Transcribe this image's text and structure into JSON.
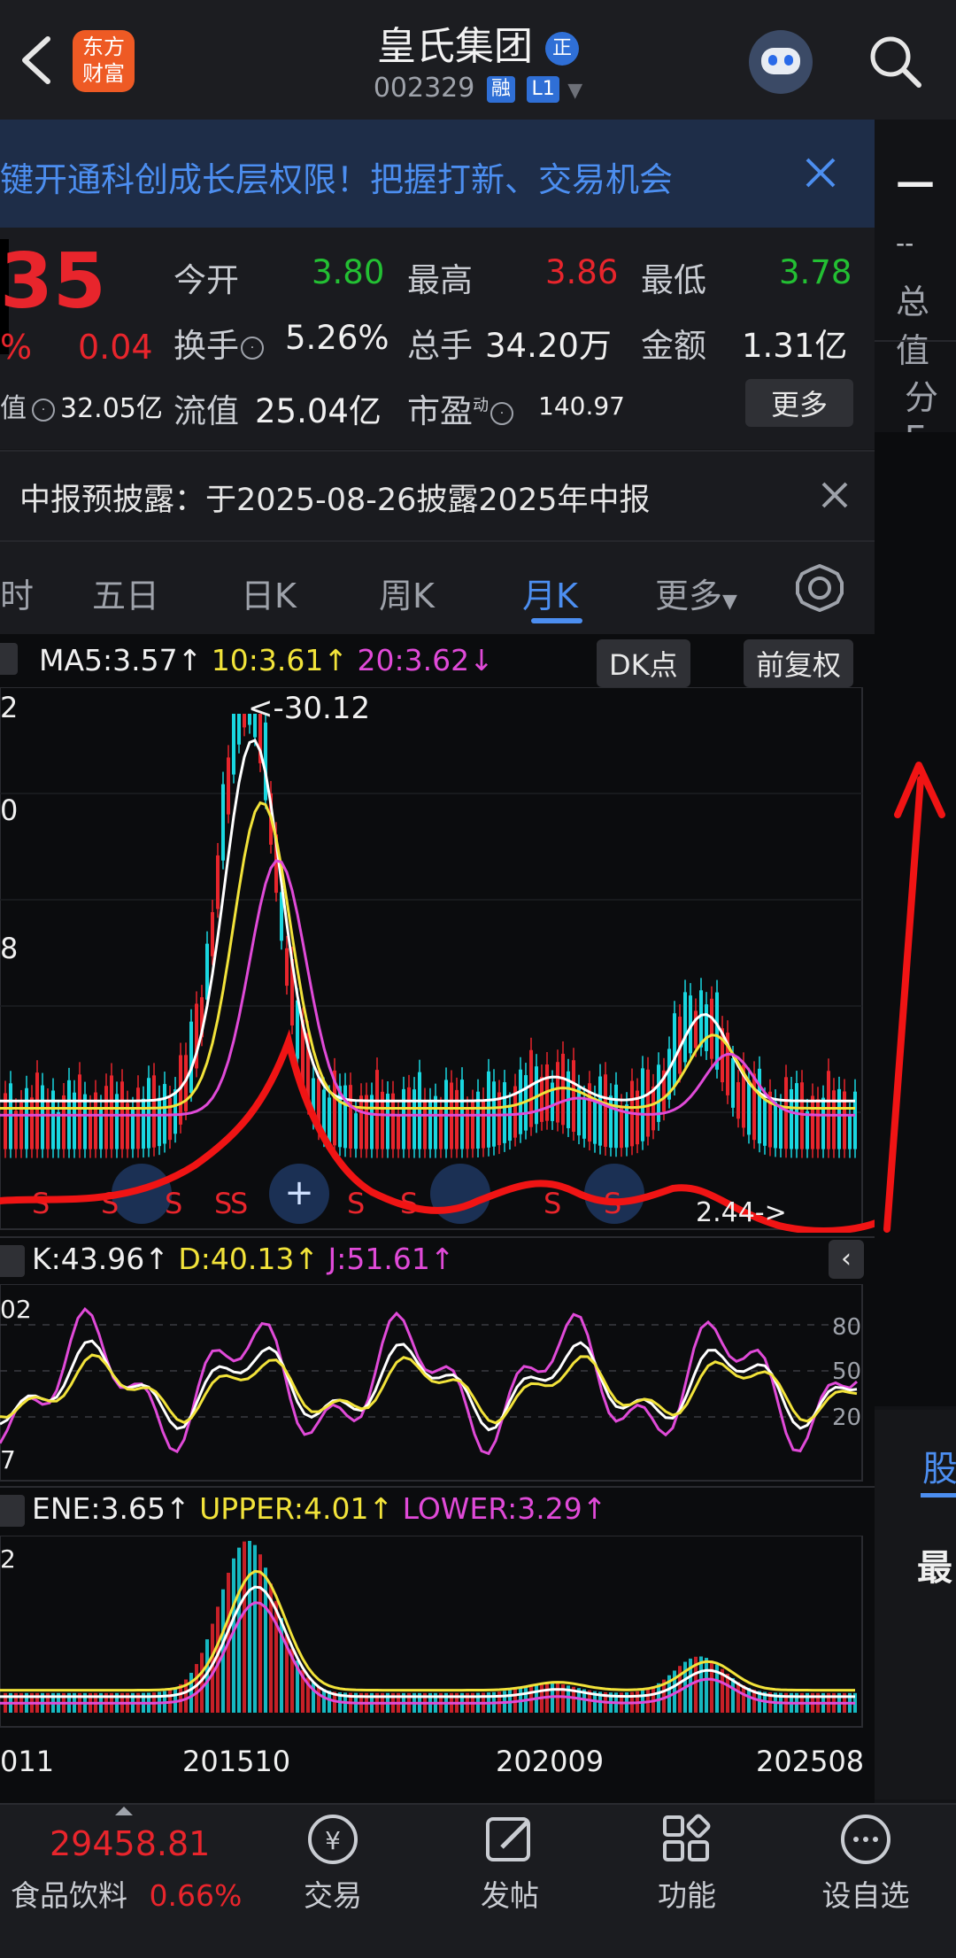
{
  "header": {
    "title": "皇氏集团",
    "badge": "正",
    "code": "002329",
    "tag_rong": "融",
    "tag_l1": "L1",
    "logo_line1": "东方",
    "logo_line2": "财富"
  },
  "banner": {
    "text": "键开通科创成长层权限！把握打新、交易机会"
  },
  "quote": {
    "price": "35",
    "pct": "%",
    "change": "0.04",
    "open_label": "今开",
    "open": "3.80",
    "high_label": "最高",
    "high": "3.86",
    "low_label": "最低",
    "low": "3.78",
    "turnover_label": "换手",
    "turnover": "5.26%",
    "volume_label": "总手",
    "volume": "34.20万",
    "amount_label": "金额",
    "amount": "1.31亿",
    "mktcap_label": "值",
    "mktcap": "32.05亿",
    "float_label": "流值",
    "float": "25.04亿",
    "pe_label": "市盈",
    "pe_sup": "动",
    "pe": "140.97",
    "more": "更多"
  },
  "notice": {
    "text": "中报预披露：于2025-08-26披露2025年中报"
  },
  "tabs": [
    "时",
    "五日",
    "日K",
    "周K",
    "月K",
    "更多"
  ],
  "active_tab": "月K",
  "main_indicator": {
    "ma5": "MA5:3.57↑",
    "ma10": "10:3.61↑",
    "ma20": "20:3.62↓",
    "dk_button": "DK点",
    "adjust_button": "前复权",
    "y_ticks": [
      "2",
      "0",
      "8"
    ],
    "max_label": "<-30.12",
    "min_label": "2.44->",
    "signals": [
      "S",
      "S",
      "S",
      "S",
      "S",
      "S",
      "S",
      "S",
      "S"
    ]
  },
  "kdj": {
    "k": "K:43.96↑",
    "d": "D:40.13↑",
    "j": "J:51.61↑",
    "y_left_top": "02",
    "y_left_bottom": "7",
    "levels": [
      "80",
      "50",
      "20"
    ]
  },
  "ene": {
    "ene": "ENE:3.65↑",
    "upper": "UPPER:4.01↑",
    "lower": "LOWER:3.29↑",
    "y_left_top": "2"
  },
  "x_axis": [
    "011",
    "201510",
    "202009",
    "202508"
  ],
  "right_panel": {
    "dash": "—",
    "dash2": "--",
    "total": "总值",
    "fen": "分E",
    "gu": "股",
    "zui": "最"
  },
  "bottom": {
    "index_value": "29458.81",
    "index_name": "食品饮料",
    "index_pct": "0.66%",
    "trade": "交易",
    "post": "发帖",
    "func": "功能",
    "watch": "设自选"
  },
  "colors": {
    "up": "#e8252c",
    "down": "#23c033",
    "accent": "#4c8ef0",
    "ma5": "#ffffff",
    "ma10": "#f2e33a",
    "ma20": "#e04ad8",
    "cyan": "#19d7e0"
  },
  "icons": [
    "back-icon",
    "logo-icon",
    "robot-avatar-icon",
    "search-icon",
    "close-icon",
    "gear-icon",
    "trade-icon",
    "post-icon",
    "function-icon",
    "watchlist-add-icon"
  ]
}
